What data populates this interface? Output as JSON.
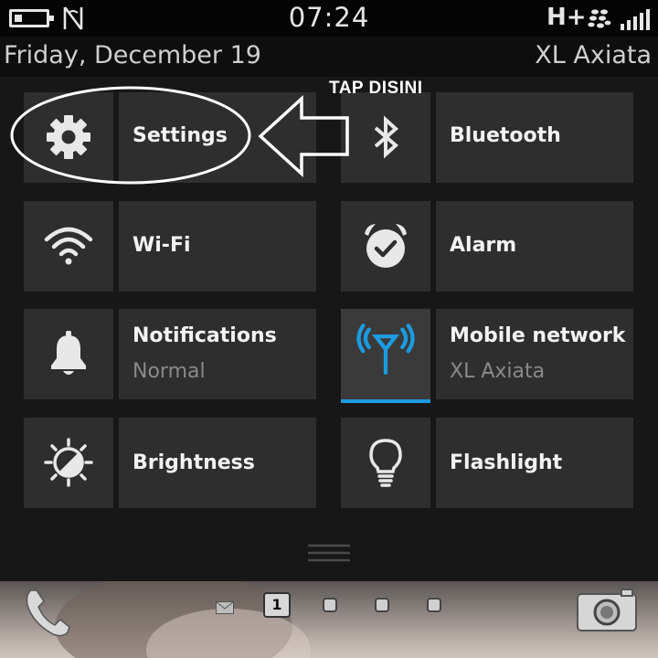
{
  "status_bar": {
    "time": "07:24",
    "network_type": "H+",
    "battery_level": 0.25,
    "signal_bars_of_5": 5,
    "icons": [
      "battery-icon",
      "nfc-icon",
      "blackberry-icon",
      "signal-icon"
    ]
  },
  "info_bar": {
    "date": "Friday, December 19",
    "carrier": "XL Axiata"
  },
  "annotation": {
    "text": "TAP DISINI"
  },
  "tiles": [
    {
      "id": "settings",
      "label": "Settings",
      "sub": "",
      "icon": "gear-icon"
    },
    {
      "id": "bluetooth",
      "label": "Bluetooth",
      "sub": "",
      "icon": "bluetooth-icon"
    },
    {
      "id": "wifi",
      "label": "Wi-Fi",
      "sub": "",
      "icon": "wifi-icon"
    },
    {
      "id": "alarm",
      "label": "Alarm",
      "sub": "",
      "icon": "alarm-clock-icon"
    },
    {
      "id": "notifications",
      "label": "Notifications",
      "sub": "Normal",
      "icon": "bell-icon"
    },
    {
      "id": "mobile-network",
      "label": "Mobile network",
      "sub": "XL Axiata",
      "icon": "antenna-icon",
      "active": true
    },
    {
      "id": "brightness",
      "label": "Brightness",
      "sub": "",
      "icon": "brightness-icon"
    },
    {
      "id": "flashlight",
      "label": "Flashlight",
      "sub": "",
      "icon": "lightbulb-icon"
    }
  ],
  "dock": {
    "current_page": "1",
    "icons": [
      "phone-icon",
      "mail-icon",
      "camera-icon"
    ]
  },
  "colors": {
    "accent": "#1c9be0",
    "tile_bg": "#2e2e2e",
    "text": "#f2f2f2",
    "subtext": "#8a8a8a"
  }
}
